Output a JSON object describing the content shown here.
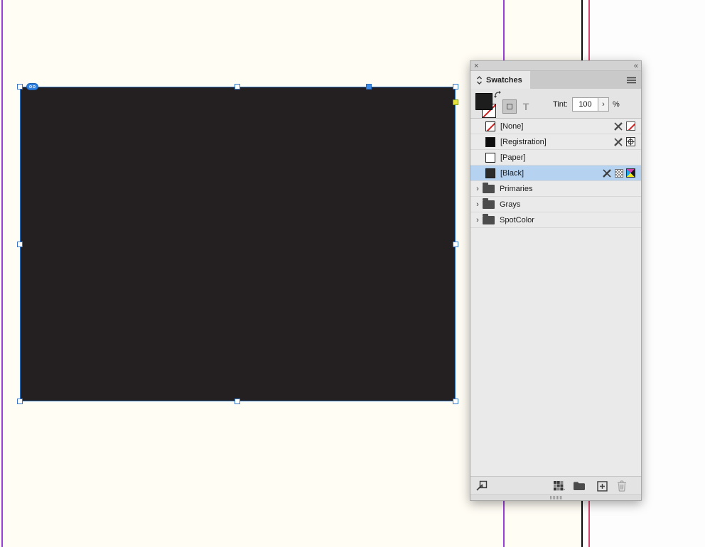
{
  "canvas": {
    "frame": {
      "description": "selected black rectangle frame"
    }
  },
  "panel": {
    "topbar": {
      "close": "×",
      "collapse": "«"
    },
    "tab_label": "Swatches",
    "controls": {
      "text_button_label": "T",
      "tint_label": "Tint:",
      "tint_value": "100",
      "tint_chevron": "›",
      "percent_label": "%"
    },
    "swatch_rows": [
      {
        "name": "[None]"
      },
      {
        "name": "[Registration]"
      },
      {
        "name": "[Paper]"
      },
      {
        "name": "[Black]"
      }
    ],
    "group_rows": [
      {
        "chevron": "›",
        "label": "Primaries"
      },
      {
        "chevron": "›",
        "label": "Grays"
      },
      {
        "chevron": "›",
        "label": "SpotColor"
      }
    ]
  },
  "colors": {
    "selection_blue": "#3f8be8",
    "selected_row_blue": "#b5d2f1",
    "guide_purple": "#9a3ed6",
    "guide_pink": "#d5466e",
    "page_edge_black": "#0a0a0a",
    "frame_fill": "#242022",
    "canvas_cream": "#fffdf4",
    "live_corner_yellow": "#e6e03c"
  }
}
